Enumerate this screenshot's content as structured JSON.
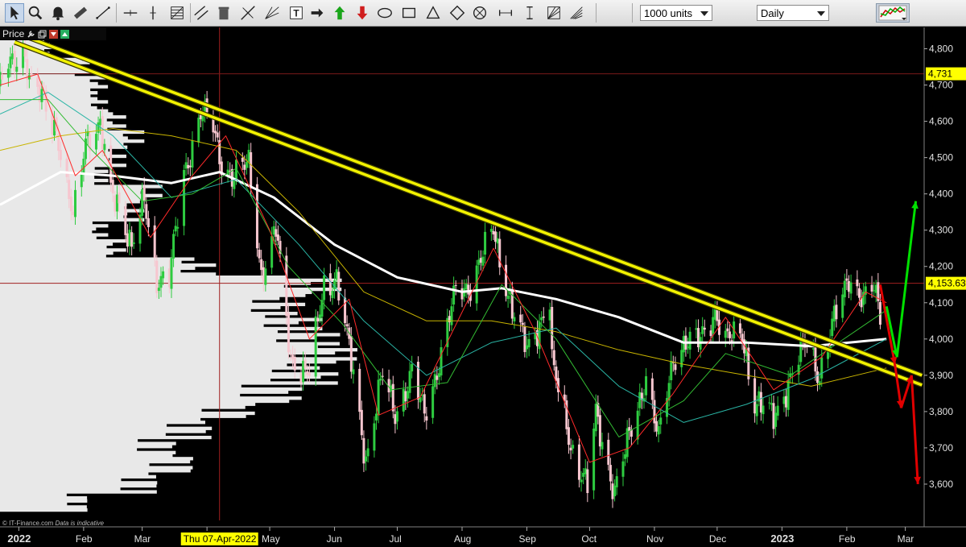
{
  "toolbar": {
    "tools": [
      {
        "name": "cursor-tool-button",
        "icon": "cursor-icon",
        "active": true
      },
      {
        "name": "zoom-tool-button",
        "icon": "magnifier-icon"
      },
      {
        "name": "alert-tool-button",
        "icon": "bell-icon"
      },
      {
        "name": "ruler-tool-button",
        "icon": "ruler-icon"
      },
      {
        "name": "trendline-tool-button",
        "icon": "trendline-icon"
      },
      {
        "name": "horizontal-line-tool-button",
        "icon": "horizontal-line-icon"
      },
      {
        "name": "vertical-line-tool-button",
        "icon": "vertical-line-icon"
      },
      {
        "name": "fibonacci-tool-button",
        "icon": "fibonacci-icon"
      },
      {
        "name": "trend-channel-tool-button",
        "icon": "channel-icon"
      },
      {
        "name": "delete-tool-button",
        "icon": "trash-icon"
      },
      {
        "name": "pitchfork-tool-button",
        "icon": "pitchfork-icon"
      },
      {
        "name": "gann-tool-button",
        "icon": "gann-icon"
      },
      {
        "name": "text-tool-button",
        "icon": "text-icon"
      },
      {
        "name": "arrow-tool-button",
        "icon": "arrow-right-icon"
      },
      {
        "name": "up-arrow-tool-button",
        "icon": "arrow-up-green-icon"
      },
      {
        "name": "down-arrow-tool-button",
        "icon": "arrow-down-red-icon"
      },
      {
        "name": "ellipse-tool-button",
        "icon": "ellipse-icon"
      },
      {
        "name": "rectangle-tool-button",
        "icon": "rectangle-icon"
      },
      {
        "name": "triangle-tool-button",
        "icon": "triangle-icon"
      },
      {
        "name": "diamond-tool-button",
        "icon": "diamond-icon"
      },
      {
        "name": "circle-cross-tool-button",
        "icon": "circle-cross-icon"
      },
      {
        "name": "range-tool-button",
        "icon": "range-icon"
      },
      {
        "name": "price-range-tool-button",
        "icon": "price-range-icon"
      },
      {
        "name": "fan-tool-button",
        "icon": "fan-icon"
      },
      {
        "name": "speed-lines-tool-button",
        "icon": "speed-lines-icon"
      }
    ],
    "units_dropdown": "1000 units",
    "period_dropdown": "Daily",
    "chart_type_button": "chart-type-icon"
  },
  "price_panel": {
    "label": "Price"
  },
  "crosshair": {
    "date_label": "Thu 07-Apr-2022",
    "price_label": "4,153.63",
    "crosshair_price": 4153.63
  },
  "last_price_label": "4,731",
  "copyright": {
    "text": "© IT-Finance.com",
    "note": "Data is indicative"
  },
  "colors": {
    "background": "#000000",
    "panel_divider": "#7f7f7f",
    "trendline": "#f2f200",
    "bull_candle": "#2ecc40",
    "bear_candle": "#f7c6cf",
    "ma_white": "#ffffff",
    "ma_red": "#ff2a2a",
    "ma_green": "#33bb33",
    "ma_cyan": "#2ab5a5",
    "ma_yellow": "#c8b400",
    "arrow_up": "#00e000",
    "arrow_down": "#e00000",
    "crosshair": "#a02020",
    "last_price_bg": "#ffff00"
  },
  "chart_data": {
    "type": "candlestick",
    "title": "",
    "ylim": [
      3500,
      4850
    ],
    "y_ticks": [
      3600,
      3700,
      3800,
      3900,
      4000,
      4100,
      4200,
      4300,
      4400,
      4500,
      4600,
      4700,
      4800
    ],
    "y_tick_labels": [
      "3,600",
      "3,700",
      "3,800",
      "3,900",
      "4,000",
      "4,100",
      "4,200",
      "4,300",
      "4,400",
      "4,500",
      "4,600",
      "4,700",
      "4,800"
    ],
    "x_start": "2021-12-23",
    "x_end": "2023-03-10",
    "x_tick_labels": [
      {
        "date": "2022-01-01",
        "label": "2022",
        "bold": true
      },
      {
        "date": "2022-02-01",
        "label": "Feb"
      },
      {
        "date": "2022-03-01",
        "label": "Mar"
      },
      {
        "date": "2022-04-01",
        "label": "Apr"
      },
      {
        "date": "2022-05-01",
        "label": "May"
      },
      {
        "date": "2022-06-01",
        "label": "Jun"
      },
      {
        "date": "2022-07-01",
        "label": "Jul"
      },
      {
        "date": "2022-08-01",
        "label": "Aug"
      },
      {
        "date": "2022-09-01",
        "label": "Sep"
      },
      {
        "date": "2022-10-01",
        "label": "Oct"
      },
      {
        "date": "2022-11-01",
        "label": "Nov"
      },
      {
        "date": "2022-12-01",
        "label": "Dec"
      },
      {
        "date": "2023-01-01",
        "label": "2023",
        "bold": true
      },
      {
        "date": "2023-02-01",
        "label": "Feb"
      },
      {
        "date": "2023-03-01",
        "label": "Mar"
      }
    ],
    "price_path": [
      [
        "2021-12-23",
        4690
      ],
      [
        "2021-12-27",
        4760
      ],
      [
        "2022-01-03",
        4800
      ],
      [
        "2022-01-07",
        4690
      ],
      [
        "2022-01-13",
        4660
      ],
      [
        "2022-01-19",
        4580
      ],
      [
        "2022-01-24",
        4400
      ],
      [
        "2022-01-27",
        4330
      ],
      [
        "2022-02-02",
        4560
      ],
      [
        "2022-02-09",
        4580
      ],
      [
        "2022-02-14",
        4400
      ],
      [
        "2022-02-18",
        4380
      ],
      [
        "2022-02-24",
        4250
      ],
      [
        "2022-03-02",
        4380
      ],
      [
        "2022-03-08",
        4170
      ],
      [
        "2022-03-14",
        4170
      ],
      [
        "2022-03-21",
        4450
      ],
      [
        "2022-03-29",
        4630
      ],
      [
        "2022-04-04",
        4580
      ],
      [
        "2022-04-07",
        4500
      ],
      [
        "2022-04-13",
        4450
      ],
      [
        "2022-04-21",
        4480
      ],
      [
        "2022-04-27",
        4180
      ],
      [
        "2022-05-04",
        4300
      ],
      [
        "2022-05-11",
        3950
      ],
      [
        "2022-05-20",
        3900
      ],
      [
        "2022-05-27",
        4150
      ],
      [
        "2022-06-02",
        4170
      ],
      [
        "2022-06-10",
        3900
      ],
      [
        "2022-06-16",
        3670
      ],
      [
        "2022-06-24",
        3900
      ],
      [
        "2022-06-30",
        3800
      ],
      [
        "2022-07-08",
        3900
      ],
      [
        "2022-07-14",
        3790
      ],
      [
        "2022-07-22",
        3960
      ],
      [
        "2022-07-29",
        4130
      ],
      [
        "2022-08-05",
        4150
      ],
      [
        "2022-08-16",
        4300
      ],
      [
        "2022-08-23",
        4130
      ],
      [
        "2022-08-26",
        4060
      ],
      [
        "2022-09-01",
        3970
      ],
      [
        "2022-09-12",
        4110
      ],
      [
        "2022-09-13",
        3930
      ],
      [
        "2022-09-23",
        3690
      ],
      [
        "2022-09-30",
        3590
      ],
      [
        "2022-10-04",
        3790
      ],
      [
        "2022-10-13",
        3580
      ],
      [
        "2022-10-21",
        3750
      ],
      [
        "2022-10-28",
        3900
      ],
      [
        "2022-11-03",
        3720
      ],
      [
        "2022-11-10",
        3950
      ],
      [
        "2022-11-15",
        3990
      ],
      [
        "2022-11-22",
        3990
      ],
      [
        "2022-11-30",
        4080
      ],
      [
        "2022-12-05",
        3990
      ],
      [
        "2022-12-13",
        4020
      ],
      [
        "2022-12-19",
        3820
      ],
      [
        "2022-12-28",
        3790
      ],
      [
        "2023-01-06",
        3900
      ],
      [
        "2023-01-13",
        4000
      ],
      [
        "2023-01-19",
        3900
      ],
      [
        "2023-01-27",
        4070
      ],
      [
        "2023-02-02",
        4180
      ],
      [
        "2023-02-09",
        4100
      ],
      [
        "2023-02-14",
        4140
      ],
      [
        "2023-02-17",
        4080
      ]
    ],
    "moving_averages": [
      {
        "color": "white",
        "points": [
          [
            "2021-12-23",
            4370
          ],
          [
            "2022-01-21",
            4460
          ],
          [
            "2022-02-15",
            4450
          ],
          [
            "2022-03-15",
            4430
          ],
          [
            "2022-04-07",
            4460
          ],
          [
            "2022-05-03",
            4390
          ],
          [
            "2022-06-01",
            4260
          ],
          [
            "2022-07-01",
            4170
          ],
          [
            "2022-08-01",
            4130
          ],
          [
            "2022-08-20",
            4140
          ],
          [
            "2022-09-15",
            4110
          ],
          [
            "2022-10-15",
            4060
          ],
          [
            "2022-11-15",
            3990
          ],
          [
            "2022-12-15",
            3990
          ],
          [
            "2023-01-15",
            3980
          ],
          [
            "2023-02-20",
            4000
          ]
        ]
      },
      {
        "color": "yellow",
        "points": [
          [
            "2021-12-23",
            4520
          ],
          [
            "2022-01-21",
            4560
          ],
          [
            "2022-02-15",
            4580
          ],
          [
            "2022-03-15",
            4560
          ],
          [
            "2022-04-15",
            4520
          ],
          [
            "2022-05-15",
            4350
          ],
          [
            "2022-06-15",
            4130
          ],
          [
            "2022-07-15",
            4050
          ],
          [
            "2022-08-15",
            4050
          ],
          [
            "2022-09-15",
            4020
          ],
          [
            "2022-10-15",
            3970
          ],
          [
            "2022-11-15",
            3930
          ],
          [
            "2022-12-15",
            3900
          ],
          [
            "2023-01-15",
            3870
          ],
          [
            "2023-02-20",
            3920
          ]
        ]
      },
      {
        "color": "cyan",
        "points": [
          [
            "2021-12-23",
            4620
          ],
          [
            "2022-01-15",
            4680
          ],
          [
            "2022-02-15",
            4560
          ],
          [
            "2022-03-15",
            4390
          ],
          [
            "2022-04-15",
            4440
          ],
          [
            "2022-05-15",
            4260
          ],
          [
            "2022-06-15",
            4050
          ],
          [
            "2022-07-15",
            3900
          ],
          [
            "2022-08-15",
            3990
          ],
          [
            "2022-09-15",
            4030
          ],
          [
            "2022-10-15",
            3870
          ],
          [
            "2022-11-15",
            3770
          ],
          [
            "2022-12-15",
            3820
          ],
          [
            "2023-01-15",
            3890
          ],
          [
            "2023-02-20",
            4000
          ]
        ]
      },
      {
        "color": "green",
        "points": [
          [
            "2021-12-23",
            4660
          ],
          [
            "2022-01-15",
            4660
          ],
          [
            "2022-02-05",
            4520
          ],
          [
            "2022-03-01",
            4380
          ],
          [
            "2022-03-25",
            4400
          ],
          [
            "2022-04-15",
            4470
          ],
          [
            "2022-05-10",
            4200
          ],
          [
            "2022-06-05",
            4040
          ],
          [
            "2022-06-28",
            3860
          ],
          [
            "2022-07-25",
            3880
          ],
          [
            "2022-08-20",
            4150
          ],
          [
            "2022-09-15",
            4000
          ],
          [
            "2022-10-15",
            3730
          ],
          [
            "2022-11-15",
            3830
          ],
          [
            "2022-12-05",
            3960
          ],
          [
            "2023-01-05",
            3900
          ],
          [
            "2023-02-20",
            4080
          ]
        ]
      },
      {
        "color": "red",
        "points": [
          [
            "2021-12-23",
            4700
          ],
          [
            "2022-01-10",
            4730
          ],
          [
            "2022-01-28",
            4450
          ],
          [
            "2022-02-10",
            4520
          ],
          [
            "2022-03-05",
            4280
          ],
          [
            "2022-03-25",
            4450
          ],
          [
            "2022-04-10",
            4560
          ],
          [
            "2022-05-01",
            4300
          ],
          [
            "2022-05-20",
            4000
          ],
          [
            "2022-06-08",
            4110
          ],
          [
            "2022-06-22",
            3790
          ],
          [
            "2022-07-12",
            3840
          ],
          [
            "2022-08-16",
            4250
          ],
          [
            "2022-09-05",
            4020
          ],
          [
            "2022-10-01",
            3660
          ],
          [
            "2022-10-20",
            3700
          ],
          [
            "2022-11-10",
            3850
          ],
          [
            "2022-12-05",
            4060
          ],
          [
            "2022-12-28",
            3860
          ],
          [
            "2023-01-20",
            3950
          ],
          [
            "2023-02-10",
            4130
          ],
          [
            "2023-02-20",
            4100
          ]
        ]
      }
    ],
    "trendlines": [
      {
        "from": [
          "2021-12-30",
          4845
        ],
        "to": [
          "2023-03-09",
          3900
        ]
      },
      {
        "from": [
          "2021-12-30",
          4818
        ],
        "to": [
          "2023-03-09",
          3873
        ]
      }
    ],
    "scenario_arrows": [
      {
        "color": "red",
        "from": [
          "2023-02-17",
          4150
        ],
        "to": [
          "2023-02-24",
          3930
        ]
      },
      {
        "color": "green",
        "from": [
          "2023-02-20",
          4090
        ],
        "to": [
          "2023-02-25",
          3950
        ]
      },
      {
        "color": "green",
        "from": [
          "2023-02-25",
          3950
        ],
        "to": [
          "2023-03-06",
          4380
        ]
      },
      {
        "color": "red",
        "from": [
          "2023-02-24",
          3930
        ],
        "to": [
          "2023-02-27",
          3810
        ]
      },
      {
        "color": "red",
        "from": [
          "2023-02-27",
          3810
        ],
        "to": [
          "2023-03-04",
          3900
        ]
      },
      {
        "color": "red",
        "from": [
          "2023-03-04",
          3900
        ],
        "to": [
          "2023-03-07",
          3600
        ]
      }
    ],
    "volume_profile": {
      "levels": [
        3550,
        3600,
        3650,
        3700,
        3750,
        3800,
        3850,
        3900,
        3950,
        4000,
        4050,
        4100,
        4150,
        4200,
        4250,
        4300,
        4350,
        4400,
        4450,
        4500,
        4550,
        4600,
        4650,
        4700,
        4750,
        4800
      ],
      "values": [
        0.25,
        0.45,
        0.55,
        0.5,
        0.6,
        0.72,
        0.85,
        0.95,
        1.0,
        0.95,
        0.9,
        0.85,
        0.95,
        0.6,
        0.35,
        0.3,
        0.4,
        0.45,
        0.3,
        0.35,
        0.4,
        0.35,
        0.3,
        0.3,
        0.25,
        0.15
      ]
    }
  }
}
